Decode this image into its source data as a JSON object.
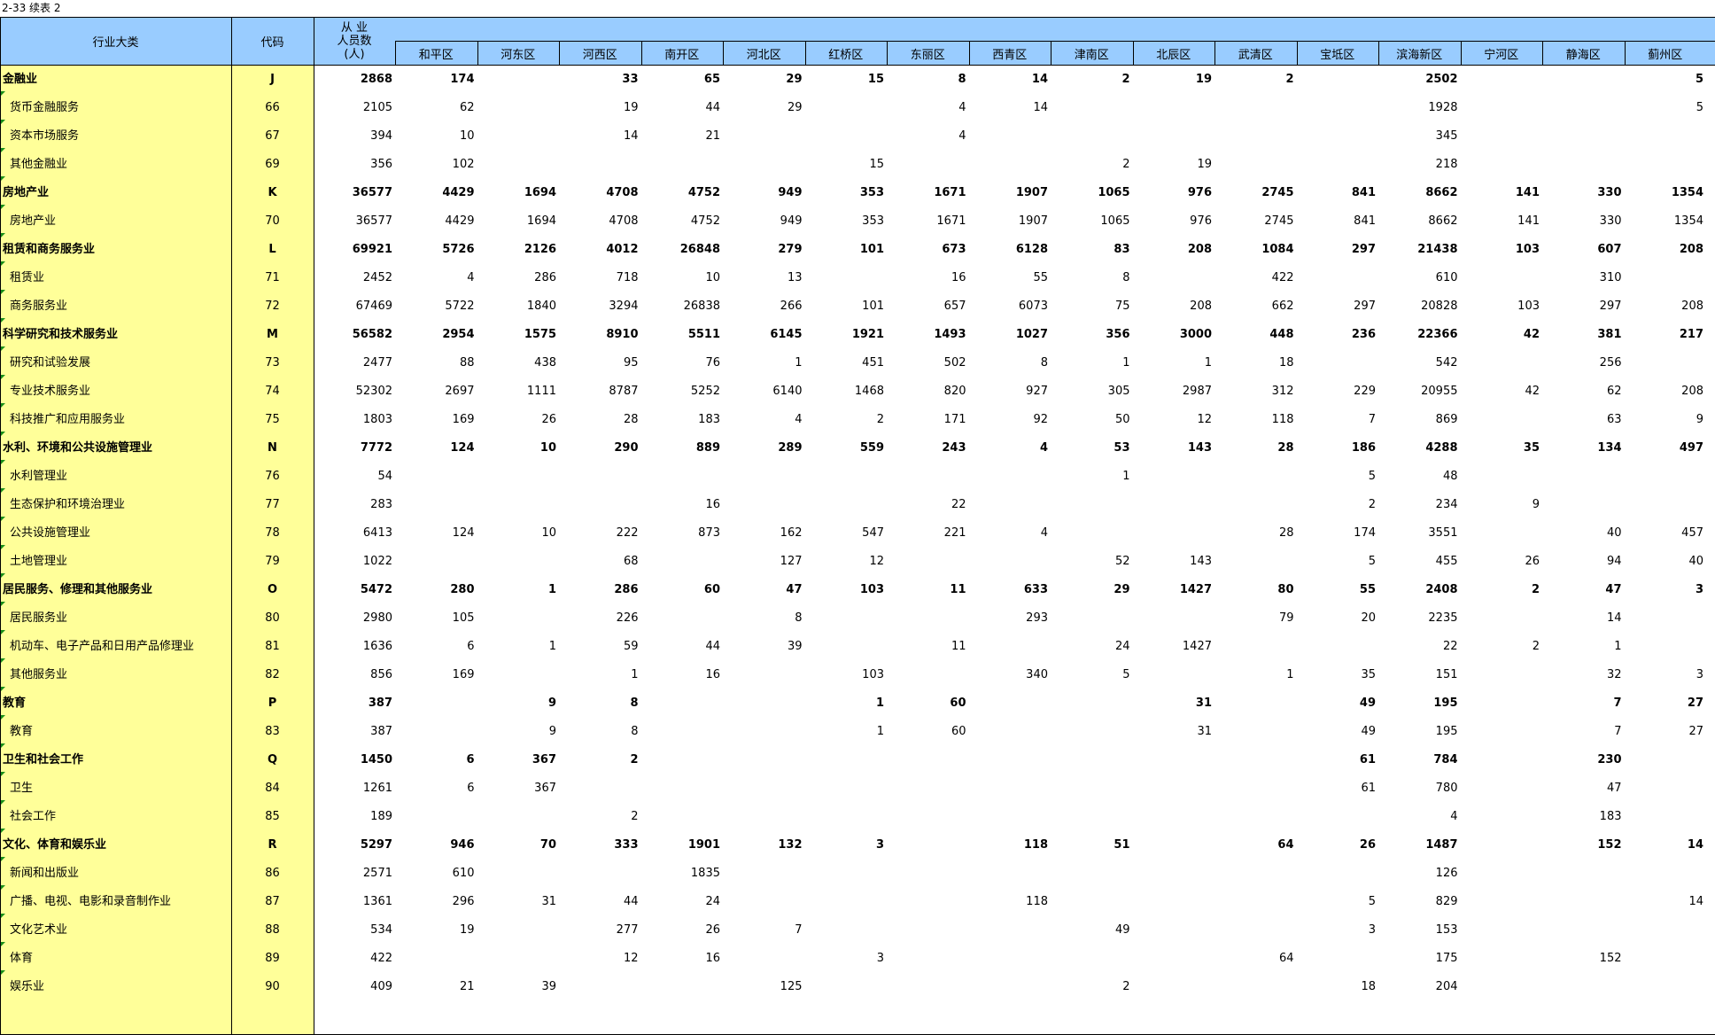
{
  "title": "2-33  续表 2",
  "header": {
    "industry": "行业大类",
    "code": "代码",
    "total_line1": "从  业",
    "total_line2": "人员数",
    "total_line3": "(人)",
    "districts": [
      "和平区",
      "河东区",
      "河西区",
      "南开区",
      "河北区",
      "红桥区",
      "东丽区",
      "西青区",
      "津南区",
      "北辰区",
      "武清区",
      "宝坻区",
      "滨海新区",
      "宁河区",
      "静海区",
      "蓟州区"
    ]
  },
  "rows": [
    {
      "name": "金融业",
      "code": "J",
      "bold": true,
      "total": "2868",
      "values": [
        "174",
        "",
        "33",
        "65",
        "29",
        "15",
        "8",
        "14",
        "2",
        "19",
        "2",
        "",
        "2502",
        "",
        "",
        "5"
      ]
    },
    {
      "name": "货币金融服务",
      "code": "66",
      "bold": false,
      "total": "2105",
      "values": [
        "62",
        "",
        "19",
        "44",
        "29",
        "",
        "4",
        "14",
        "",
        "",
        "",
        "",
        "1928",
        "",
        "",
        "5"
      ]
    },
    {
      "name": "资本市场服务",
      "code": "67",
      "bold": false,
      "total": "394",
      "values": [
        "10",
        "",
        "14",
        "21",
        "",
        "",
        "4",
        "",
        "",
        "",
        "",
        "",
        "345",
        "",
        "",
        ""
      ]
    },
    {
      "name": "其他金融业",
      "code": "69",
      "bold": false,
      "total": "356",
      "values": [
        "102",
        "",
        "",
        "",
        "",
        "15",
        "",
        "",
        "2",
        "19",
        "",
        "",
        "218",
        "",
        "",
        ""
      ]
    },
    {
      "name": "房地产业",
      "code": "K",
      "bold": true,
      "total": "36577",
      "values": [
        "4429",
        "1694",
        "4708",
        "4752",
        "949",
        "353",
        "1671",
        "1907",
        "1065",
        "976",
        "2745",
        "841",
        "8662",
        "141",
        "330",
        "1354"
      ]
    },
    {
      "name": "房地产业",
      "code": "70",
      "bold": false,
      "total": "36577",
      "values": [
        "4429",
        "1694",
        "4708",
        "4752",
        "949",
        "353",
        "1671",
        "1907",
        "1065",
        "976",
        "2745",
        "841",
        "8662",
        "141",
        "330",
        "1354"
      ]
    },
    {
      "name": "租赁和商务服务业",
      "code": "L",
      "bold": true,
      "total": "69921",
      "values": [
        "5726",
        "2126",
        "4012",
        "26848",
        "279",
        "101",
        "673",
        "6128",
        "83",
        "208",
        "1084",
        "297",
        "21438",
        "103",
        "607",
        "208"
      ]
    },
    {
      "name": "租赁业",
      "code": "71",
      "bold": false,
      "total": "2452",
      "values": [
        "4",
        "286",
        "718",
        "10",
        "13",
        "",
        "16",
        "55",
        "8",
        "",
        "422",
        "",
        "610",
        "",
        "310",
        ""
      ]
    },
    {
      "name": "商务服务业",
      "code": "72",
      "bold": false,
      "total": "67469",
      "values": [
        "5722",
        "1840",
        "3294",
        "26838",
        "266",
        "101",
        "657",
        "6073",
        "75",
        "208",
        "662",
        "297",
        "20828",
        "103",
        "297",
        "208"
      ]
    },
    {
      "name": "科学研究和技术服务业",
      "code": "M",
      "bold": true,
      "total": "56582",
      "values": [
        "2954",
        "1575",
        "8910",
        "5511",
        "6145",
        "1921",
        "1493",
        "1027",
        "356",
        "3000",
        "448",
        "236",
        "22366",
        "42",
        "381",
        "217"
      ]
    },
    {
      "name": "研究和试验发展",
      "code": "73",
      "bold": false,
      "total": "2477",
      "values": [
        "88",
        "438",
        "95",
        "76",
        "1",
        "451",
        "502",
        "8",
        "1",
        "1",
        "18",
        "",
        "542",
        "",
        "256",
        ""
      ]
    },
    {
      "name": "专业技术服务业",
      "code": "74",
      "bold": false,
      "total": "52302",
      "values": [
        "2697",
        "1111",
        "8787",
        "5252",
        "6140",
        "1468",
        "820",
        "927",
        "305",
        "2987",
        "312",
        "229",
        "20955",
        "42",
        "62",
        "208"
      ]
    },
    {
      "name": "科技推广和应用服务业",
      "code": "75",
      "bold": false,
      "total": "1803",
      "values": [
        "169",
        "26",
        "28",
        "183",
        "4",
        "2",
        "171",
        "92",
        "50",
        "12",
        "118",
        "7",
        "869",
        "",
        "63",
        "9"
      ]
    },
    {
      "name": "水利、环境和公共设施管理业",
      "code": "N",
      "bold": true,
      "total": "7772",
      "values": [
        "124",
        "10",
        "290",
        "889",
        "289",
        "559",
        "243",
        "4",
        "53",
        "143",
        "28",
        "186",
        "4288",
        "35",
        "134",
        "497"
      ]
    },
    {
      "name": "水利管理业",
      "code": "76",
      "bold": false,
      "total": "54",
      "values": [
        "",
        "",
        "",
        "",
        "",
        "",
        "",
        "",
        "1",
        "",
        "",
        "5",
        "48",
        "",
        "",
        ""
      ]
    },
    {
      "name": "生态保护和环境治理业",
      "code": "77",
      "bold": false,
      "total": "283",
      "values": [
        "",
        "",
        "",
        "16",
        "",
        "",
        "22",
        "",
        "",
        "",
        "",
        "2",
        "234",
        "9",
        "",
        ""
      ]
    },
    {
      "name": "公共设施管理业",
      "code": "78",
      "bold": false,
      "total": "6413",
      "values": [
        "124",
        "10",
        "222",
        "873",
        "162",
        "547",
        "221",
        "4",
        "",
        "",
        "28",
        "174",
        "3551",
        "",
        "40",
        "457"
      ]
    },
    {
      "name": "土地管理业",
      "code": "79",
      "bold": false,
      "total": "1022",
      "values": [
        "",
        "",
        "68",
        "",
        "127",
        "12",
        "",
        "",
        "52",
        "143",
        "",
        "5",
        "455",
        "26",
        "94",
        "40"
      ]
    },
    {
      "name": "居民服务、修理和其他服务业",
      "code": "O",
      "bold": true,
      "total": "5472",
      "values": [
        "280",
        "1",
        "286",
        "60",
        "47",
        "103",
        "11",
        "633",
        "29",
        "1427",
        "80",
        "55",
        "2408",
        "2",
        "47",
        "3"
      ]
    },
    {
      "name": "居民服务业",
      "code": "80",
      "bold": false,
      "total": "2980",
      "values": [
        "105",
        "",
        "226",
        "",
        "8",
        "",
        "",
        "293",
        "",
        "",
        "79",
        "20",
        "2235",
        "",
        "14",
        ""
      ]
    },
    {
      "name": "机动车、电子产品和日用产品修理业",
      "code": "81",
      "bold": false,
      "total": "1636",
      "values": [
        "6",
        "1",
        "59",
        "44",
        "39",
        "",
        "11",
        "",
        "24",
        "1427",
        "",
        "",
        "22",
        "2",
        "1",
        ""
      ]
    },
    {
      "name": "其他服务业",
      "code": "82",
      "bold": false,
      "total": "856",
      "values": [
        "169",
        "",
        "1",
        "16",
        "",
        "103",
        "",
        "340",
        "5",
        "",
        "1",
        "35",
        "151",
        "",
        "32",
        "3"
      ]
    },
    {
      "name": "教育",
      "code": "P",
      "bold": true,
      "total": "387",
      "values": [
        "",
        "9",
        "8",
        "",
        "",
        "1",
        "60",
        "",
        "",
        "31",
        "",
        "49",
        "195",
        "",
        "7",
        "27"
      ]
    },
    {
      "name": "教育",
      "code": "83",
      "bold": false,
      "total": "387",
      "values": [
        "",
        "9",
        "8",
        "",
        "",
        "1",
        "60",
        "",
        "",
        "31",
        "",
        "49",
        "195",
        "",
        "7",
        "27"
      ]
    },
    {
      "name": "卫生和社会工作",
      "code": "Q",
      "bold": true,
      "total": "1450",
      "values": [
        "6",
        "367",
        "2",
        "",
        "",
        "",
        "",
        "",
        "",
        "",
        "",
        "61",
        "784",
        "",
        "230",
        ""
      ]
    },
    {
      "name": "卫生",
      "code": "84",
      "bold": false,
      "total": "1261",
      "values": [
        "6",
        "367",
        "",
        "",
        "",
        "",
        "",
        "",
        "",
        "",
        "",
        "61",
        "780",
        "",
        "47",
        ""
      ]
    },
    {
      "name": "社会工作",
      "code": "85",
      "bold": false,
      "total": "189",
      "values": [
        "",
        "",
        "2",
        "",
        "",
        "",
        "",
        "",
        "",
        "",
        "",
        "",
        "4",
        "",
        "183",
        ""
      ]
    },
    {
      "name": "文化、体育和娱乐业",
      "code": "R",
      "bold": true,
      "total": "5297",
      "values": [
        "946",
        "70",
        "333",
        "1901",
        "132",
        "3",
        "",
        "118",
        "51",
        "",
        "64",
        "26",
        "1487",
        "",
        "152",
        "14"
      ]
    },
    {
      "name": "新闻和出版业",
      "code": "86",
      "bold": false,
      "total": "2571",
      "values": [
        "610",
        "",
        "",
        "1835",
        "",
        "",
        "",
        "",
        "",
        "",
        "",
        "",
        "126",
        "",
        "",
        ""
      ]
    },
    {
      "name": "广播、电视、电影和录音制作业",
      "code": "87",
      "bold": false,
      "total": "1361",
      "values": [
        "296",
        "31",
        "44",
        "24",
        "",
        "",
        "",
        "118",
        "",
        "",
        "",
        "5",
        "829",
        "",
        "",
        "14"
      ]
    },
    {
      "name": "文化艺术业",
      "code": "88",
      "bold": false,
      "total": "534",
      "values": [
        "19",
        "",
        "277",
        "26",
        "7",
        "",
        "",
        "",
        "49",
        "",
        "",
        "3",
        "153",
        "",
        "",
        ""
      ]
    },
    {
      "name": "体育",
      "code": "89",
      "bold": false,
      "total": "422",
      "values": [
        "",
        "",
        "12",
        "16",
        "",
        "3",
        "",
        "",
        "",
        "",
        "64",
        "",
        "175",
        "",
        "152",
        ""
      ]
    },
    {
      "name": "娱乐业",
      "code": "90",
      "bold": false,
      "total": "409",
      "values": [
        "21",
        "39",
        "",
        "",
        "125",
        "",
        "",
        "",
        "2",
        "",
        "",
        "18",
        "204",
        "",
        "",
        ""
      ]
    }
  ]
}
